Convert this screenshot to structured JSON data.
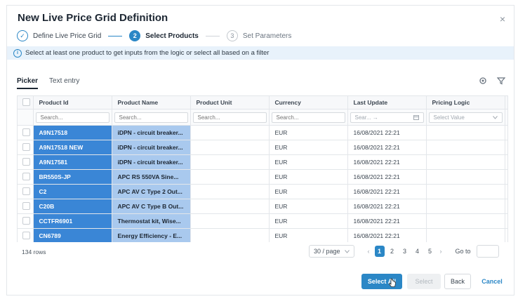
{
  "dialog": {
    "title": "New Live Price Grid Definition",
    "close_glyph": "×"
  },
  "steps": [
    {
      "marker": "✓",
      "label": "Define Live Price Grid",
      "state": "done"
    },
    {
      "marker": "2",
      "label": "Select Products",
      "state": "active"
    },
    {
      "marker": "3",
      "label": "Set Parameters",
      "state": "todo"
    }
  ],
  "info_banner": {
    "icon": "info-icon",
    "text": "Select at least one product to get inputs from the logic or select all based on a filter"
  },
  "tabs": [
    {
      "label": "Picker",
      "active": true
    },
    {
      "label": "Text entry",
      "active": false
    }
  ],
  "toolbar": {
    "settings_icon": "gear-icon",
    "filter_icon": "filter-icon"
  },
  "grid": {
    "columns": [
      {
        "header": "Product Id",
        "filter_placeholder": "Search..."
      },
      {
        "header": "Product Name",
        "filter_placeholder": "Search..."
      },
      {
        "header": "Product Unit",
        "filter_placeholder": "Search..."
      },
      {
        "header": "Currency",
        "filter_placeholder": "Search..."
      },
      {
        "header": "Last Update",
        "filter_placeholder": "Sear... →"
      },
      {
        "header": "Pricing Logic",
        "filter_placeholder": "Select Value"
      }
    ],
    "rows": [
      {
        "id": "A9N17518",
        "name": "iDPN - circuit breaker...",
        "unit": "",
        "currency": "EUR",
        "updated": "16/08/2021 22:21",
        "logic": ""
      },
      {
        "id": "A9N17518 NEW",
        "name": "iDPN - circuit breaker...",
        "unit": "",
        "currency": "EUR",
        "updated": "16/08/2021 22:21",
        "logic": ""
      },
      {
        "id": "A9N17581",
        "name": "iDPN - circuit breaker...",
        "unit": "",
        "currency": "EUR",
        "updated": "16/08/2021 22:21",
        "logic": ""
      },
      {
        "id": "BR550S-JP",
        "name": "APC RS 550VA Sine...",
        "unit": "",
        "currency": "EUR",
        "updated": "16/08/2021 22:21",
        "logic": ""
      },
      {
        "id": "C2",
        "name": "APC AV C Type 2 Out...",
        "unit": "",
        "currency": "EUR",
        "updated": "16/08/2021 22:21",
        "logic": ""
      },
      {
        "id": "C20B",
        "name": "APC AV C Type B Out...",
        "unit": "",
        "currency": "EUR",
        "updated": "16/08/2021 22:21",
        "logic": ""
      },
      {
        "id": "CCTFR6901",
        "name": "Thermostat kit, Wise...",
        "unit": "",
        "currency": "EUR",
        "updated": "16/08/2021 22:21",
        "logic": ""
      },
      {
        "id": "CN6789",
        "name": "Energy Efficiency - E...",
        "unit": "",
        "currency": "EUR",
        "updated": "16/08/2021 22:21",
        "logic": ""
      }
    ]
  },
  "footer": {
    "row_count": "134 rows",
    "page_size": "30 / page",
    "pages": [
      "1",
      "2",
      "3",
      "4",
      "5"
    ],
    "current_page": "1",
    "prev_glyph": "‹",
    "next_glyph": "›",
    "goto_label": "Go to"
  },
  "actions": {
    "select_all": "Select All",
    "select": "Select",
    "back": "Back",
    "cancel": "Cancel"
  },
  "colors": {
    "accent": "#2b87c6",
    "selection_primary": "#3a86d6",
    "selection_secondary": "#a9c9ee",
    "banner_bg": "#e8f2fb"
  }
}
